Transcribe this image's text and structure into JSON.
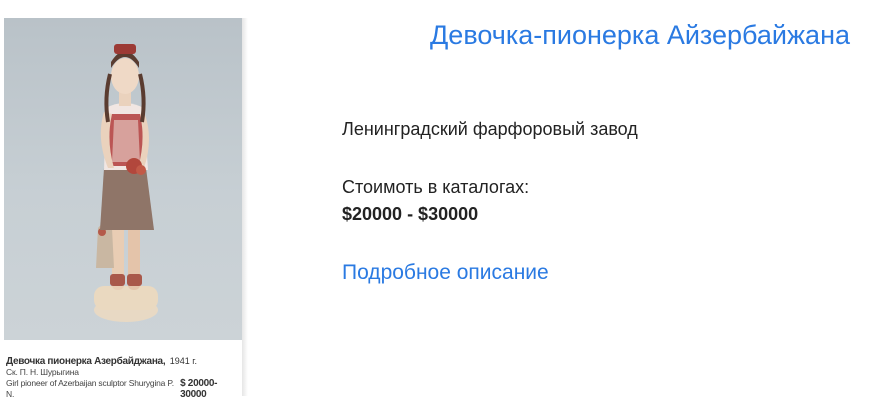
{
  "product": {
    "title": "Девочка-пионерка Айзербайжана",
    "manufacturer": "Ленинградский фарфоровый завод",
    "price_label": "Стоимоть в каталогах:",
    "price_range": "$20000 - $30000",
    "details_link": "Подробное описание"
  },
  "catalog_image": {
    "caption_title": "Девочка пионерка Азербайджана,",
    "caption_year": "1941 г.",
    "caption_sculptor_ru": "Ск. П. Н. Шурыгина",
    "caption_sculptor_en": "Girl pioneer of Azerbaijan sculptor Shurygina P. N.",
    "caption_price": "$ 20000-30000"
  },
  "colors": {
    "link": "#2a7ae2",
    "text": "#222222"
  }
}
